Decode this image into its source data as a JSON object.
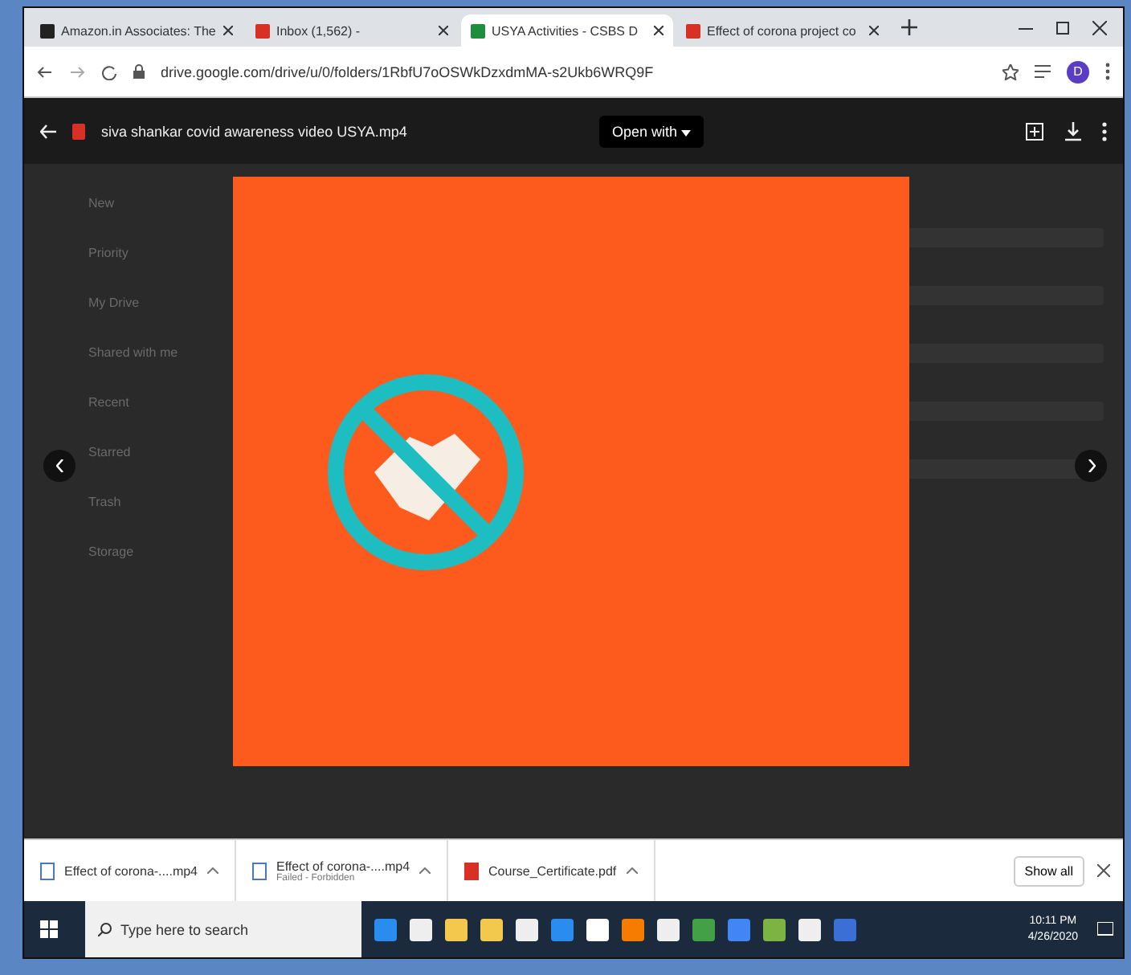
{
  "browser": {
    "tabs": [
      {
        "title": "Amazon.in Associates: The",
        "kind": "amazon",
        "selected": false
      },
      {
        "title": "Inbox (1,562) - ",
        "kind": "gmail",
        "selected": false
      },
      {
        "title": "USYA Activities - CSBS D",
        "kind": "drive",
        "selected": true
      },
      {
        "title": "Effect of corona project co",
        "kind": "slides",
        "selected": false
      }
    ],
    "url": "drive.google.com/drive/u/0/folders/1RbfU7oOSWkDzxdmMA-s2Ukb6WRQ9F",
    "profile": "D"
  },
  "viewer": {
    "file_name": "siva shankar covid awareness video USYA.mp4",
    "open_with": "Open with"
  },
  "drive_sidebar": {
    "items": [
      "New",
      "Priority",
      "My Drive",
      "Shared with me",
      "Recent",
      "Starred",
      "Trash",
      "Storage"
    ]
  },
  "downloads": {
    "items": [
      {
        "name": "Effect of corona-....mp4"
      },
      {
        "name": "Effect of corona-....mp4",
        "status": "Failed - Forbidden"
      },
      {
        "name": "Course_Certificate.pdf",
        "kind": "pdf"
      }
    ],
    "show_all": "Show all"
  },
  "taskbar": {
    "search_placeholder": "Type here to search",
    "time": "10:11 PM",
    "date": "4/26/2020"
  }
}
